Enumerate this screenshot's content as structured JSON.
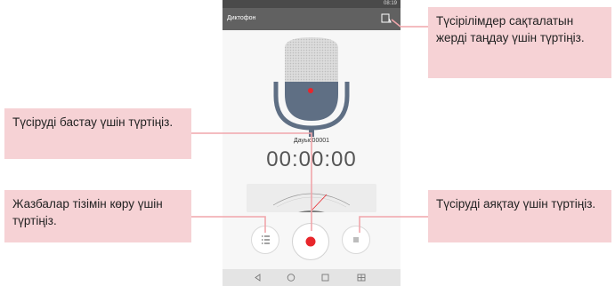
{
  "status_bar": {
    "time": "08:19"
  },
  "app_bar": {
    "title": "Диктофон"
  },
  "recording": {
    "name": "Дауыс00001",
    "timer": "00:00:00"
  },
  "callouts": {
    "location": "Түсірілімдер сақталатын жерді таңдау үшін түртіңіз.",
    "start": "Түсіруді бастау үшін түртіңіз.",
    "list": "Жазбалар тізімін көру үшін түртіңіз.",
    "stop": "Түсіруді аяқтау үшін түртіңіз."
  },
  "icons": {
    "microphone": "microphone-icon",
    "location": "storage-location-icon",
    "list": "list-icon",
    "record": "record-icon",
    "stop": "stop-icon",
    "back": "back-icon",
    "home": "home-icon",
    "recent": "recent-apps-icon",
    "dual_window": "dual-window-icon"
  },
  "colors": {
    "record_red": "#e8262b",
    "callout_bg": "#f6d2d5",
    "leader_line": "#f0a6ab",
    "app_bar": "#616161"
  }
}
